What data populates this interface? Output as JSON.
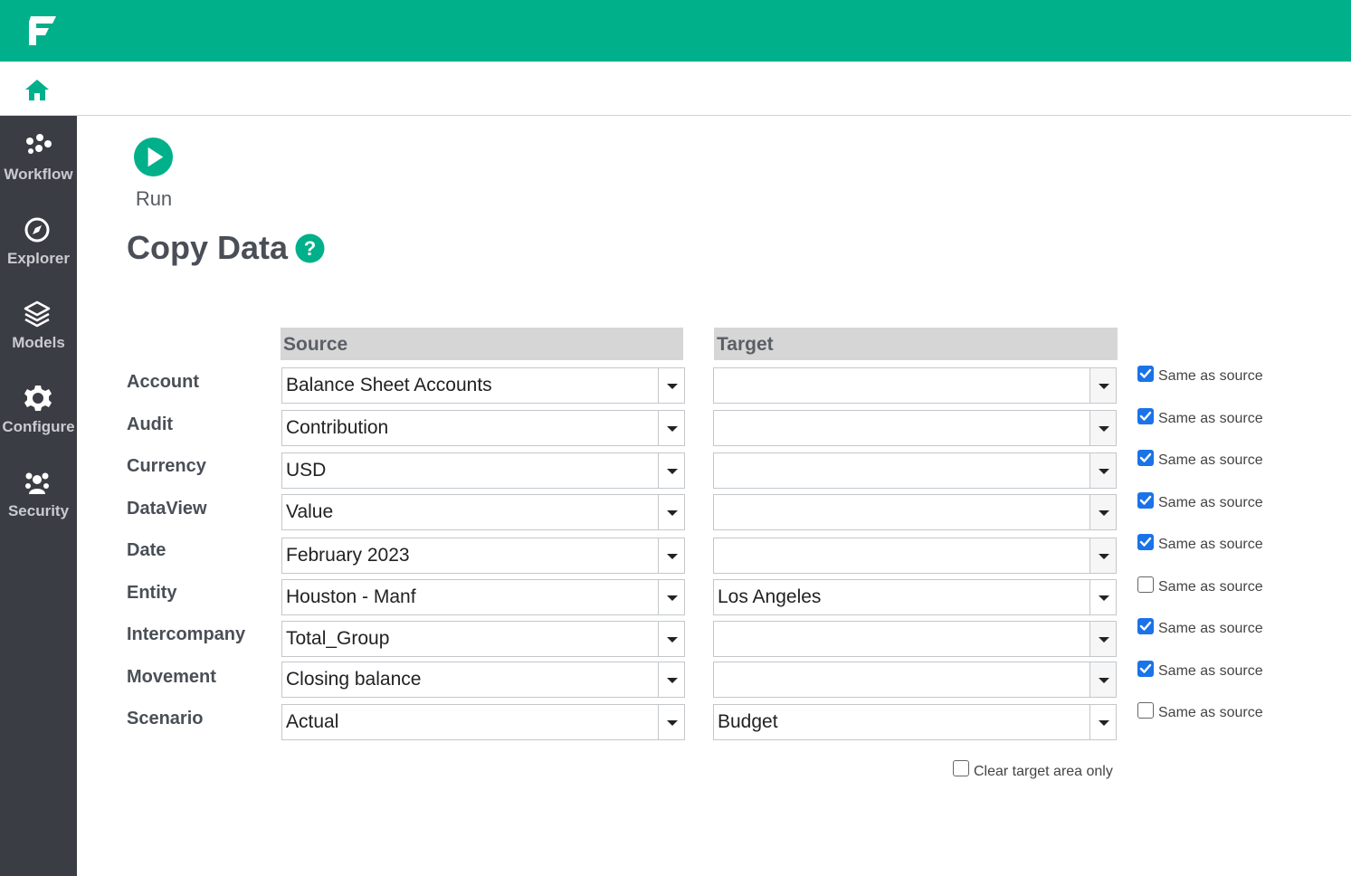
{
  "colors": {
    "brand": "#00b08b",
    "sidebar": "#3b3d45",
    "header_bg": "#d6d6d6",
    "checkbox": "#1a73e8"
  },
  "nav": {
    "items": [
      {
        "label": "Workflow",
        "icon": "workflow-icon"
      },
      {
        "label": "Explorer",
        "icon": "compass-icon"
      },
      {
        "label": "Models",
        "icon": "layers-icon"
      },
      {
        "label": "Configure",
        "icon": "gear-icon"
      },
      {
        "label": "Security",
        "icon": "users-icon"
      }
    ]
  },
  "toolbar": {
    "run_label": "Run"
  },
  "page": {
    "title": "Copy Data"
  },
  "columns": {
    "source": "Source",
    "target": "Target"
  },
  "rows": [
    {
      "label": "Account",
      "source": "Balance Sheet Accounts",
      "target": "",
      "same_as_source": true,
      "same_label": "Same as source"
    },
    {
      "label": "Audit",
      "source": "Contribution",
      "target": "",
      "same_as_source": true,
      "same_label": "Same as source"
    },
    {
      "label": "Currency",
      "source": "USD",
      "target": "",
      "same_as_source": true,
      "same_label": "Same as source"
    },
    {
      "label": "DataView",
      "source": "Value",
      "target": "",
      "same_as_source": true,
      "same_label": "Same as source"
    },
    {
      "label": "Date",
      "source": "February 2023",
      "target": "",
      "same_as_source": true,
      "same_label": "Same as source"
    },
    {
      "label": "Entity",
      "source": "Houston - Manf",
      "target": "Los Angeles",
      "same_as_source": false,
      "same_label": "Same as source"
    },
    {
      "label": "Intercompany",
      "source": "Total_Group",
      "target": "",
      "same_as_source": true,
      "same_label": "Same as source"
    },
    {
      "label": "Movement",
      "source": "Closing balance",
      "target": "",
      "same_as_source": true,
      "same_label": "Same as source"
    },
    {
      "label": "Scenario",
      "source": "Actual",
      "target": "Budget",
      "same_as_source": false,
      "same_label": "Same as source"
    }
  ],
  "options": {
    "clear_target_label": "Clear target area only",
    "clear_target_checked": false
  }
}
